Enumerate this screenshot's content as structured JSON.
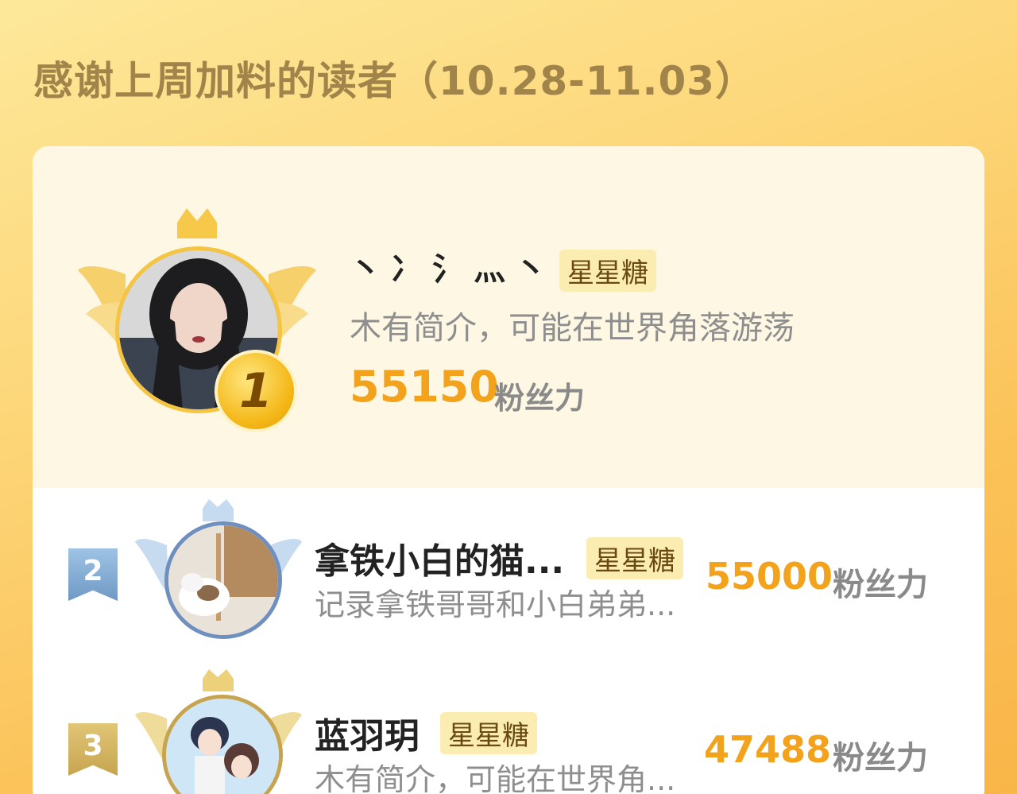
{
  "page": {
    "title": "感谢上周加料的读者（10.28-11.03）"
  },
  "colors": {
    "background_top": "#fde89a",
    "background_bottom": "#f9b548",
    "accent_orange": "#f3a21c",
    "badge_bg": "#fbedb2",
    "gold": "#f5c542",
    "silver_blue": "#6f99c5",
    "bronze": "#c7a450"
  },
  "ranking": [
    {
      "rank": "1",
      "name": "丶冫氵灬丶",
      "badge": "星星糖",
      "intro": "木有简介，可能在世界角落游荡",
      "score": "55150",
      "score_unit": "粉丝力",
      "avatar_icon": "girl-portrait-avatar"
    },
    {
      "rank": "2",
      "name": "拿铁小白的猫...",
      "badge": "星星糖",
      "intro": "记录拿铁哥哥和小白弟弟...",
      "score": "55000",
      "score_unit": "粉丝力",
      "avatar_icon": "cat-photo-avatar"
    },
    {
      "rank": "3",
      "name": "蓝羽玥",
      "badge": "星星糖",
      "intro": "木有简介，可能在世界角...",
      "score": "47488",
      "score_unit": "粉丝力",
      "avatar_icon": "anime-couple-avatar"
    }
  ]
}
